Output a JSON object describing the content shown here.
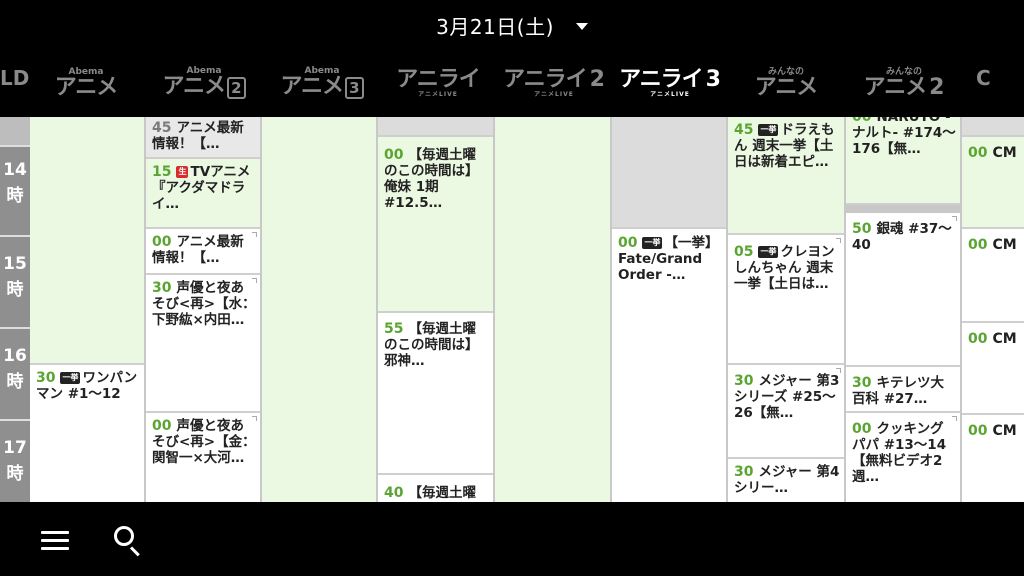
{
  "header": {
    "date": "3月21日(土)"
  },
  "channels": [
    {
      "sub": "",
      "main": "LD",
      "num": "",
      "stub": true
    },
    {
      "sub": "Abema",
      "main": "アニメ",
      "num": ""
    },
    {
      "sub": "Abema",
      "main": "アニメ",
      "num": "2"
    },
    {
      "sub": "Abema",
      "main": "アニメ",
      "num": "3"
    },
    {
      "sub": "",
      "main": "アニライ",
      "num": "",
      "live": "アニメLIVE"
    },
    {
      "sub": "",
      "main": "アニライ",
      "num": "2",
      "live": "アニメLIVE"
    },
    {
      "sub": "",
      "main": "アニライ",
      "num": "3",
      "live": "アニメLIVE",
      "active": true
    },
    {
      "sub": "みんなの",
      "main": "アニメ",
      "num": ""
    },
    {
      "sub": "みんなの",
      "main": "アニメ",
      "num": "2"
    },
    {
      "sub": "",
      "main": "C",
      "num": "",
      "stub": true
    }
  ],
  "hours": [
    {
      "h": "14",
      "suffix": "時"
    },
    {
      "h": "15",
      "suffix": "時"
    },
    {
      "h": "16",
      "suffix": "時"
    },
    {
      "h": "17",
      "suffix": "時"
    }
  ],
  "programs": {
    "col1": [
      {
        "min": "30",
        "badge": "一挙",
        "title": "ワンパンマン #1〜12"
      }
    ],
    "col2": [
      {
        "min": "45",
        "badge": "",
        "title": "アニメ最新情報！【…"
      },
      {
        "min": "15",
        "badge": "生",
        "title": "TVアニメ『アクダマドライ…"
      },
      {
        "min": "00",
        "badge": "",
        "title": "アニメ最新情報！【…"
      },
      {
        "min": "30",
        "badge": "",
        "title": "声優と夜あそび<再>【水：下野紘×内田…"
      },
      {
        "min": "00",
        "badge": "",
        "title": "声優と夜あそび<再>【金：関智一×大河…"
      }
    ],
    "col4": [
      {
        "min": "00",
        "badge": "",
        "title": "【毎週土曜のこの時間は】俺妹 1期 #12.5…"
      },
      {
        "min": "55",
        "badge": "",
        "title": "【毎週土曜のこの時間は】邪神…"
      },
      {
        "min": "40",
        "badge": "",
        "title": "【毎週土曜"
      }
    ],
    "col6": [
      {
        "min": "00",
        "badge": "一挙",
        "title": "【一挙】Fate/Grand Order -…"
      }
    ],
    "col7": [
      {
        "min": "45",
        "badge": "一挙",
        "title": "ドラえもん 週末一挙【土日は新着エピ…"
      },
      {
        "min": "05",
        "badge": "一挙",
        "title": "クレヨンしんちゃん 週末一挙【土日は…"
      },
      {
        "min": "30",
        "badge": "",
        "title": "メジャー 第3シリーズ #25〜26【無…"
      },
      {
        "min": "30",
        "badge": "",
        "title": "メジャー 第4シリー…"
      }
    ],
    "col8": [
      {
        "min": "00",
        "badge": "",
        "title": "NARUTO -ナルト- #174〜176【無…"
      },
      {
        "min": "50",
        "badge": "",
        "title": "銀魂 #37〜40"
      },
      {
        "min": "30",
        "badge": "",
        "title": "キテレツ大百科 #27…"
      },
      {
        "min": "00",
        "badge": "",
        "title": "クッキングパパ #13〜14【無料ビデオ2週…"
      }
    ],
    "col9": [
      {
        "min": "00",
        "title": "CM"
      },
      {
        "min": "00",
        "title": "CM"
      },
      {
        "min": "00",
        "title": "CM"
      },
      {
        "min": "00",
        "title": "CM"
      }
    ]
  },
  "colors": {
    "minute": "#5aa532",
    "green_cell": "#ecf9e2",
    "hour_bg": "#8f8f8f"
  },
  "icons": {
    "menu": "menu-icon",
    "search": "search-icon"
  }
}
